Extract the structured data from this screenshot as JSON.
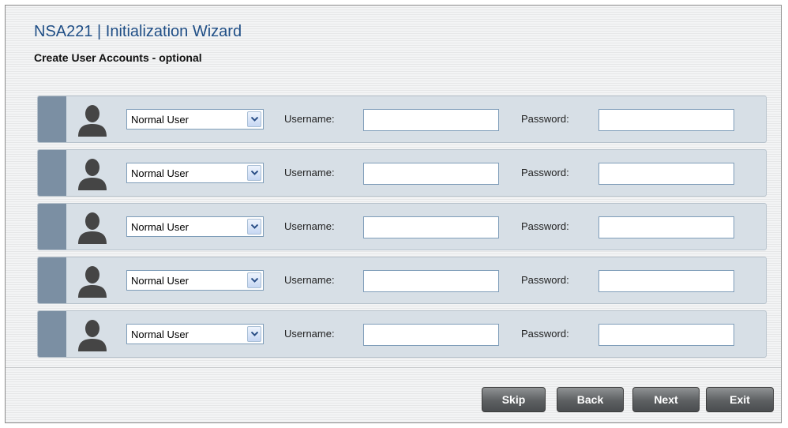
{
  "wizard": {
    "title": "NSA221 | Initialization Wizard",
    "subtitle": "Create User Accounts - optional"
  },
  "user_rows": [
    {
      "role": "Normal User",
      "username_label": "Username:",
      "username_value": "",
      "password_label": "Password:",
      "password_value": ""
    },
    {
      "role": "Normal User",
      "username_label": "Username:",
      "username_value": "",
      "password_label": "Password:",
      "password_value": ""
    },
    {
      "role": "Normal User",
      "username_label": "Username:",
      "username_value": "",
      "password_label": "Password:",
      "password_value": ""
    },
    {
      "role": "Normal User",
      "username_label": "Username:",
      "username_value": "",
      "password_label": "Password:",
      "password_value": ""
    },
    {
      "role": "Normal User",
      "username_label": "Username:",
      "username_value": "",
      "password_label": "Password:",
      "password_value": ""
    }
  ],
  "buttons": {
    "skip": "Skip",
    "back": "Back",
    "next": "Next",
    "exit": "Exit"
  },
  "icons": {
    "avatar": "user-silhouette-icon",
    "dropdown": "chevron-down-icon"
  },
  "colors": {
    "title": "#1f4e86",
    "row_background": "#d7dfe6",
    "row_tab": "#7b8fa3",
    "button": "#5d6062"
  }
}
